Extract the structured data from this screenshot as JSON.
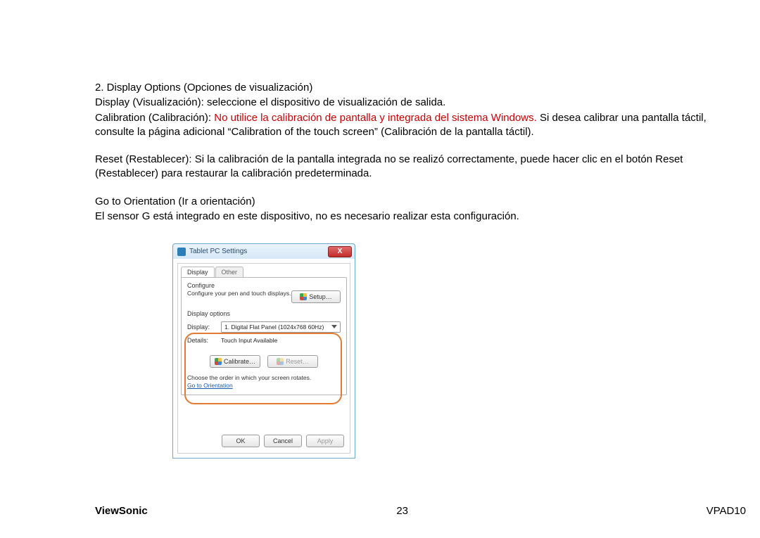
{
  "doc": {
    "heading": "2. Display Options (Opciones de visualización)",
    "p1": "Display (Visualización): seleccione el dispositivo de visualización de salida.",
    "p2a": "Calibration (Calibración): ",
    "p2_red": "No utilice la calibración de pantalla y integrada del sistema Windows.",
    "p2b": " Si desea calibrar una pantalla táctil, consulte la página adicional  “Calibration of the touch screen” (Calibración de la pantalla táctil).",
    "p3": "Reset (Restablecer): Si la calibración de la pantalla integrada no se realizó correctamente, puede hacer clic en el botón Reset (Restablecer) para restaurar la calibración predeterminada.",
    "p4": "Go to Orientation (Ir a orientación)",
    "p5": "El sensor G está integrado en este dispositivo, no es necesario realizar esta configuración."
  },
  "dialog": {
    "title": "Tablet PC Settings",
    "close": "X",
    "tabs": {
      "active": "Display",
      "inactive": "Other"
    },
    "configure": {
      "label": "Configure",
      "desc": "Configure your pen and touch displays.",
      "setup_btn": "Setup…"
    },
    "display_options": {
      "label": "Display options",
      "display_lbl": "Display:",
      "display_value": "1. Digital Flat Panel (1024x768 60Hz)",
      "details_lbl": "Details:",
      "details_value": "Touch Input Available",
      "calibrate_btn": "Calibrate…",
      "reset_btn": "Reset…"
    },
    "orientation": {
      "desc": "Choose the order in which your screen rotates.",
      "link": "Go to Orientation"
    },
    "buttons": {
      "ok": "OK",
      "cancel": "Cancel",
      "apply": "Apply"
    }
  },
  "footer": {
    "brand": "ViewSonic",
    "page": "23",
    "model": "VPAD10"
  }
}
